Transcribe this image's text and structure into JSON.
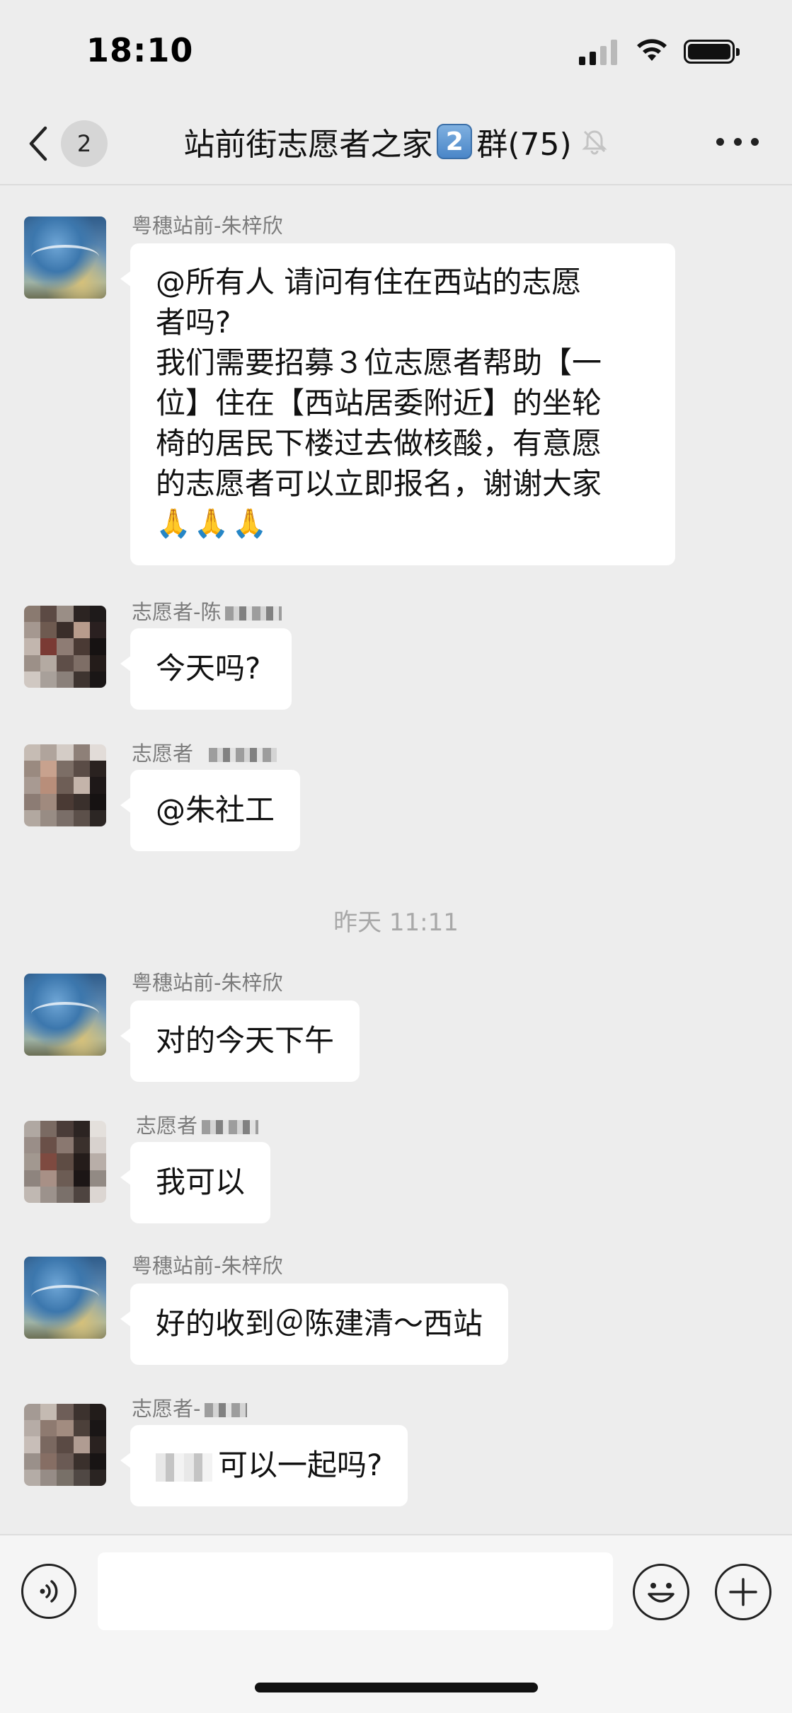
{
  "status_bar": {
    "time": "18:10"
  },
  "nav": {
    "unread_count": "2",
    "title_prefix": "站前街志愿者之家",
    "title_keycap": "2",
    "title_suffix": "群(75)"
  },
  "timestamp": "昨天 11:11",
  "messages": [
    {
      "sender": "粤穗站前-朱梓欣",
      "lines": [
        "@所有人  请问有住在西站的志愿",
        "者吗?",
        "我们需要招募３位志愿者帮助【一",
        "位】住在【西站居委附近】的坐轮",
        "椅的居民下楼过去做核酸，有意愿",
        "的志愿者可以立即报名，谢谢大家"
      ],
      "emoji": "🙏🙏🙏",
      "avatar": "sky"
    },
    {
      "sender": "志愿者-陈",
      "text": "今天吗?",
      "avatar": "pixel"
    },
    {
      "sender": "志愿者",
      "text": "@朱社工",
      "avatar": "pixel"
    },
    {
      "sender": "粤穗站前-朱梓欣",
      "text": "对的今天下午",
      "avatar": "sky"
    },
    {
      "sender": "志愿者",
      "text": "我可以",
      "avatar": "pixel"
    },
    {
      "sender": "粤穗站前-朱梓欣",
      "text": "好的收到＠陈建清～西站",
      "avatar": "sky"
    },
    {
      "sender": "志愿者-",
      "text": "可以一起吗?",
      "avatar": "pixel"
    }
  ],
  "icons": {
    "back": "chevron-left-icon",
    "mute": "bell-muted-icon",
    "more": "ellipsis-icon",
    "voice": "voice-icon",
    "emoji": "smiley-icon",
    "plus": "plus-icon"
  }
}
